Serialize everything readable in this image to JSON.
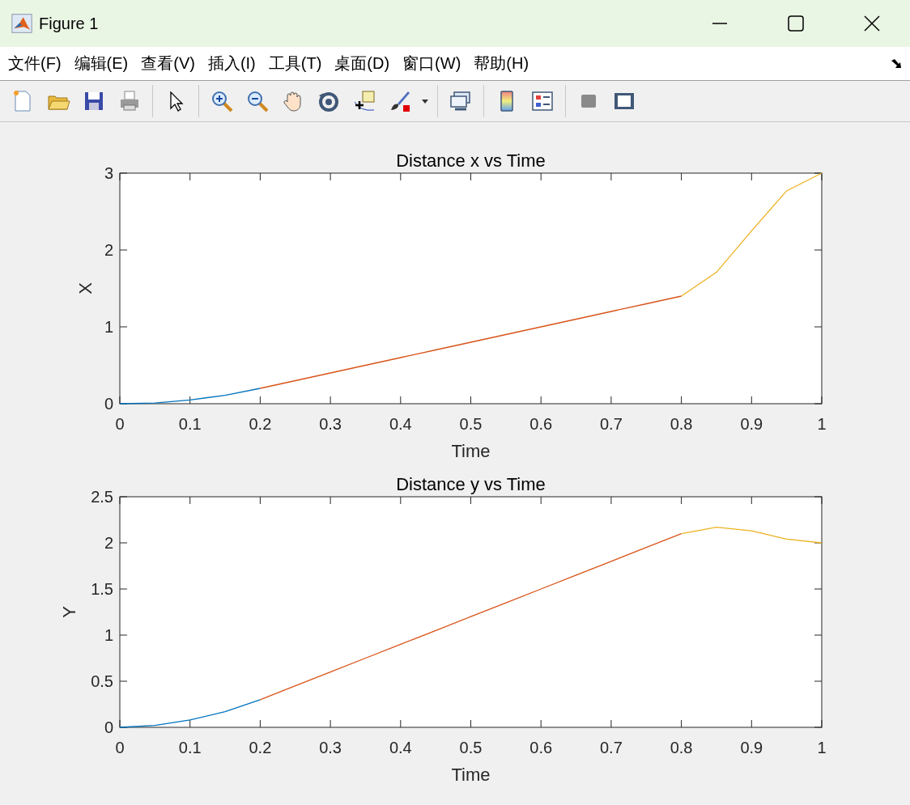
{
  "window": {
    "title": "Figure 1"
  },
  "menu": [
    {
      "label": "文件(F)"
    },
    {
      "label": "编辑(E)"
    },
    {
      "label": "查看(V)"
    },
    {
      "label": "插入(I)"
    },
    {
      "label": "工具(T)"
    },
    {
      "label": "桌面(D)"
    },
    {
      "label": "窗口(W)"
    },
    {
      "label": "帮助(H)"
    }
  ],
  "axes": [
    {
      "chart_data": {
        "type": "line",
        "title": "Distance x vs Time",
        "xlabel": "Time",
        "ylabel": "X",
        "x": [
          0,
          0.05,
          0.1,
          0.15,
          0.2,
          0.25,
          0.3,
          0.35,
          0.4,
          0.45,
          0.5,
          0.55,
          0.6,
          0.65,
          0.7,
          0.75,
          0.8,
          0.85,
          0.9,
          0.95,
          1
        ],
        "xlim": [
          0,
          1
        ],
        "ylim": [
          0,
          3
        ],
        "xticks": [
          0,
          0.1,
          0.2,
          0.3,
          0.4,
          0.5,
          0.6,
          0.7,
          0.8,
          0.9,
          1
        ],
        "yticks": [
          0,
          1,
          2,
          3
        ],
        "series": [
          {
            "color": "#0072bd",
            "values": [
              0,
              0.01,
              0.05,
              0.11,
              0.2,
              null,
              null,
              null,
              null,
              null,
              null,
              null,
              null,
              null,
              null,
              null,
              null,
              null,
              null,
              null,
              null
            ]
          },
          {
            "color": "#d95319",
            "values": [
              null,
              null,
              null,
              null,
              0.2,
              0.3,
              0.4,
              0.5,
              0.6,
              0.7,
              0.8,
              0.9,
              1.0,
              1.1,
              1.2,
              1.3,
              1.4,
              null,
              null,
              null,
              null
            ]
          },
          {
            "color": "#edb120",
            "values": [
              null,
              null,
              null,
              null,
              null,
              null,
              null,
              null,
              null,
              null,
              null,
              null,
              null,
              null,
              null,
              null,
              1.4,
              1.71,
              2.25,
              2.77,
              3
            ]
          }
        ]
      }
    },
    {
      "chart_data": {
        "type": "line",
        "title": "Distance y vs Time",
        "xlabel": "Time",
        "ylabel": "Y",
        "x": [
          0,
          0.05,
          0.1,
          0.15,
          0.2,
          0.25,
          0.3,
          0.35,
          0.4,
          0.45,
          0.5,
          0.55,
          0.6,
          0.65,
          0.7,
          0.75,
          0.8,
          0.85,
          0.9,
          0.95,
          1
        ],
        "xlim": [
          0,
          1
        ],
        "ylim": [
          0,
          2.5
        ],
        "xticks": [
          0,
          0.1,
          0.2,
          0.3,
          0.4,
          0.5,
          0.6,
          0.7,
          0.8,
          0.9,
          1
        ],
        "yticks": [
          0,
          0.5,
          1,
          1.5,
          2,
          2.5
        ],
        "series": [
          {
            "color": "#0072bd",
            "values": [
              0,
              0.02,
              0.08,
              0.17,
              0.3,
              null,
              null,
              null,
              null,
              null,
              null,
              null,
              null,
              null,
              null,
              null,
              null,
              null,
              null,
              null,
              null
            ]
          },
          {
            "color": "#d95319",
            "values": [
              null,
              null,
              null,
              null,
              0.3,
              0.45,
              0.6,
              0.75,
              0.9,
              1.05,
              1.2,
              1.35,
              1.5,
              1.65,
              1.8,
              1.95,
              2.1,
              null,
              null,
              null,
              null
            ]
          },
          {
            "color": "#edb120",
            "values": [
              null,
              null,
              null,
              null,
              null,
              null,
              null,
              null,
              null,
              null,
              null,
              null,
              null,
              null,
              null,
              null,
              2.1,
              2.17,
              2.13,
              2.04,
              2
            ]
          }
        ]
      }
    }
  ]
}
